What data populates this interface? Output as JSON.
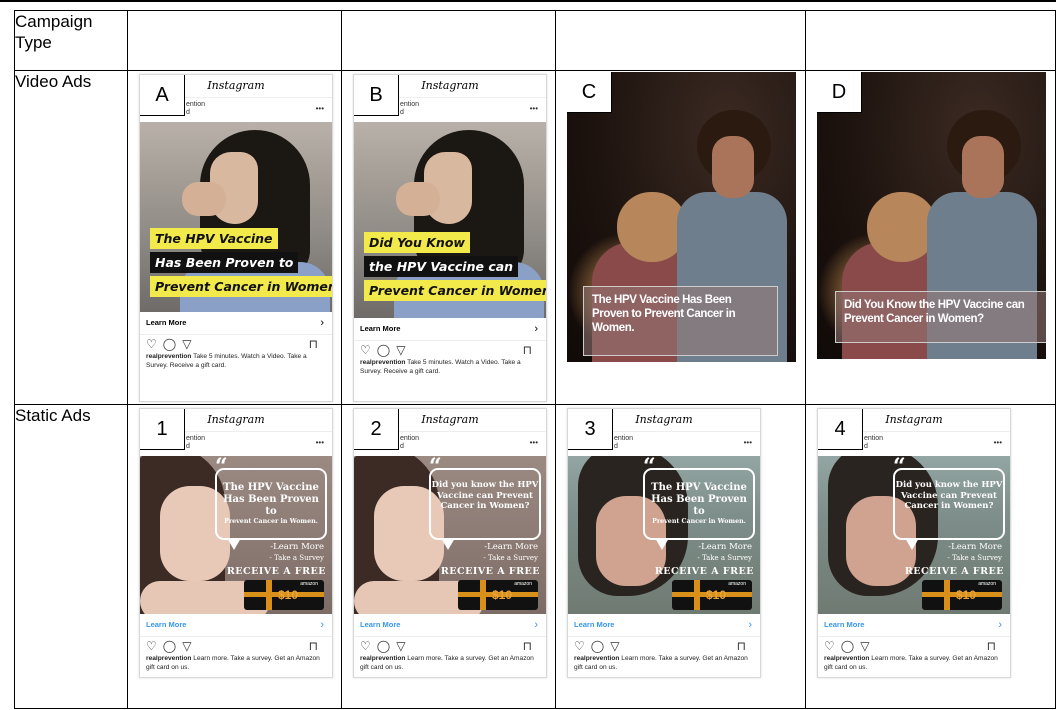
{
  "header_labels": {
    "campaign_type": "Campaign Type"
  },
  "rows": {
    "video_label": "Video Ads",
    "static_label": "Static Ads"
  },
  "instagram": {
    "app_name": "Instagram",
    "account_fragment_1": "ention",
    "account_fragment_2": "d",
    "more_dots": "•••",
    "learn_more": "Learn More"
  },
  "video_ads": [
    {
      "letter": "A",
      "lines": [
        "The HPV Vaccine",
        "Has Been Proven to",
        "Prevent Cancer in Women."
      ],
      "caption_user": "realprevention",
      "caption_text": " Take 5 minutes. Watch a Video. Take a Survey. Receive a gift card."
    },
    {
      "letter": "B",
      "lines": [
        "Did You Know",
        "the HPV Vaccine can",
        "Prevent Cancer in Women?"
      ],
      "caption_user": "realprevention",
      "caption_text": " Take 5 minutes. Watch a Video. Take a Survey. Receive a gift card."
    },
    {
      "letter": "C",
      "overlay": "The HPV Vaccine Has Been Proven to Prevent Cancer in Women."
    },
    {
      "letter": "D",
      "overlay": "Did You Know the HPV Vaccine can Prevent Cancer in Women?"
    }
  ],
  "static_ads": [
    {
      "number": "1",
      "headline": "The HPV Vaccine Has Been Proven to",
      "subline": "Prevent Cancer in Women.",
      "cta1": "-Learn More",
      "cta2": "- Take a Survey",
      "receive": "RECEIVE A FREE",
      "gift": "$10",
      "amazon": "amazon",
      "caption_user": "realprevention",
      "caption_text": " Learn more. Take a survey. Get an Amazon gift card on us."
    },
    {
      "number": "2",
      "headline": "Did you know the HPV Vaccine can Prevent Cancer in Women?",
      "subline": "",
      "cta1": "-Learn More",
      "cta2": "- Take a Survey",
      "receive": "RECEIVE A FREE",
      "gift": "$10",
      "amazon": "amazon",
      "caption_user": "realprevention",
      "caption_text": " Learn more. Take a survey. Get an Amazon gift card on us."
    },
    {
      "number": "3",
      "headline": "The HPV Vaccine Has Been Proven to",
      "subline": "Prevent Cancer in Women.",
      "cta1": "-Learn More",
      "cta2": "- Take a Survey",
      "receive": "RECEIVE A FREE",
      "gift": "$10",
      "amazon": "amazon",
      "caption_user": "realprevention",
      "caption_text": " Learn more. Take a survey. Get an Amazon gift card on us."
    },
    {
      "number": "4",
      "headline": "Did you know the HPV Vaccine can Prevent Cancer in Women?",
      "subline": "",
      "cta1": "-Learn More",
      "cta2": "- Take a Survey",
      "receive": "RECEIVE A FREE",
      "gift": "$10",
      "amazon": "amazon",
      "caption_user": "realprevention",
      "caption_text": " Learn more. Take a survey. Get an Amazon gift card on us."
    }
  ],
  "icons": {
    "heart": "heart-icon",
    "comment": "comment-icon",
    "share": "share-icon",
    "bookmark": "bookmark-icon",
    "chevron": "chevron-right-icon"
  }
}
